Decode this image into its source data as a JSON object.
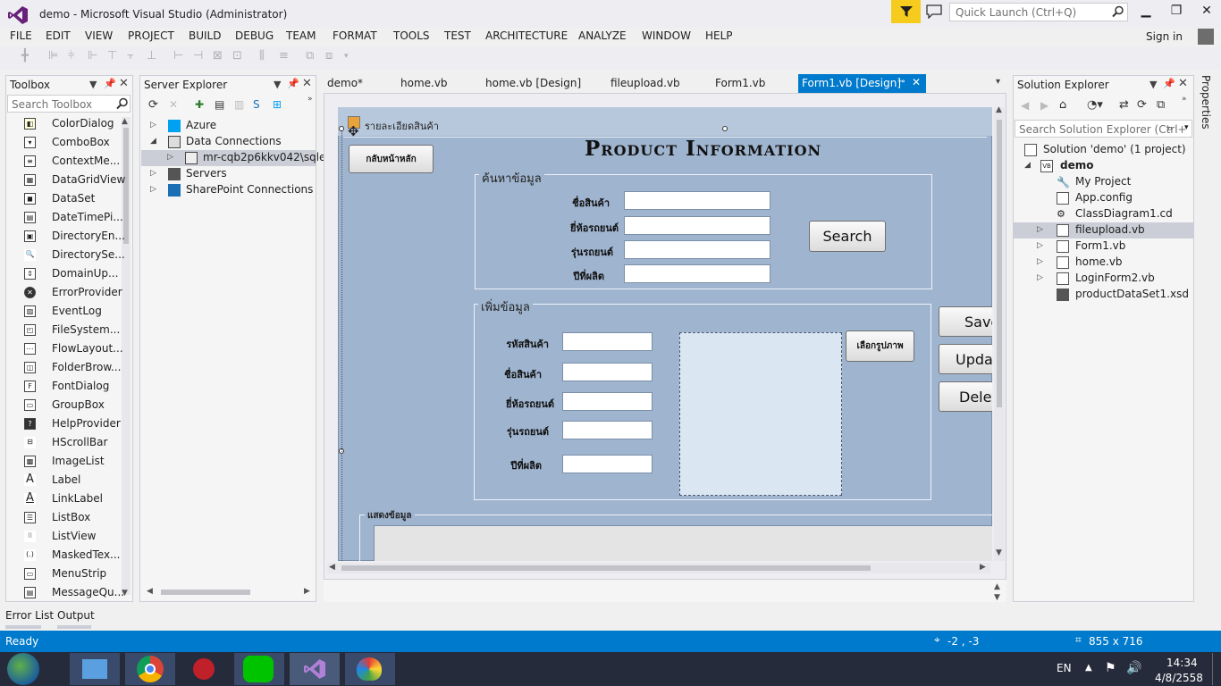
{
  "window": {
    "title": "demo - Microsoft Visual Studio (Administrator)",
    "quick_launch_placeholder": "Quick Launch (Ctrl+Q)",
    "min": "▁",
    "max": "❐",
    "close": "✕",
    "accent": "#007acc"
  },
  "menu": [
    "FILE",
    "EDIT",
    "VIEW",
    "PROJECT",
    "BUILD",
    "DEBUG",
    "TEAM",
    "FORMAT",
    "TOOLS",
    "TEST",
    "ARCHITECTURE",
    "ANALYZE",
    "WINDOW",
    "HELP"
  ],
  "signin": "Sign in",
  "toolbox": {
    "title": "Toolbox",
    "search_placeholder": "Search Toolbox",
    "items": [
      "ColorDialog",
      "ComboBox",
      "ContextMe...",
      "DataGridView",
      "DataSet",
      "DateTimePi...",
      "DirectoryEn...",
      "DirectorySe...",
      "DomainUp...",
      "ErrorProvider",
      "EventLog",
      "FileSystem...",
      "FlowLayout...",
      "FolderBrow...",
      "FontDialog",
      "GroupBox",
      "HelpProvider",
      "HScrollBar",
      "ImageList",
      "Label",
      "LinkLabel",
      "ListBox",
      "ListView",
      "MaskedTex...",
      "MenuStrip",
      "MessageQu..."
    ]
  },
  "server_explorer": {
    "title": "Server Explorer",
    "nodes": [
      "Azure",
      "Data Connections",
      "mr-cqb2p6kkv042\\sqlex",
      "Servers",
      "SharePoint Connections"
    ]
  },
  "doc_tabs": [
    "demo*",
    "home.vb",
    "home.vb [Design]",
    "fileupload.vb",
    "Form1.vb",
    "Form1.vb [Design]"
  ],
  "form": {
    "caption": "รายละเอียดสินค้า",
    "heading": "Product Information",
    "back_button": "กลับหน้าหลัก",
    "search_group": {
      "title": "ค้นหาข้อมูล",
      "labels": [
        "ชื่อสินค้า",
        "ยี่ห้อรถยนต์",
        "รุ่นรถยนต์",
        "ปีที่ผลิต"
      ],
      "search_button": "Search"
    },
    "add_group": {
      "title": "เพิ่มข้อมูล",
      "labels": [
        "รหัสสินค้า",
        "ชื่อสินค้า",
        "ยี่ห้อรถยนต์",
        "รุ่นรถยนต์",
        "ปีที่ผลิต"
      ],
      "pick_image_button": "เลือกรูปภาพ"
    },
    "save_button": "Save",
    "update_button": "Upda",
    "delete_button": "Delet",
    "display_group": "แสดงข้อมูล"
  },
  "solution_explorer": {
    "title": "Solution Explorer",
    "search_placeholder": "Search Solution Explorer (Ctrl+",
    "solution": "Solution 'demo' (1 project)",
    "project": "demo",
    "items": [
      "My Project",
      "App.config",
      "ClassDiagram1.cd",
      "fileupload.vb",
      "Form1.vb",
      "home.vb",
      "LoginForm2.vb",
      "productDataSet1.xsd"
    ]
  },
  "properties_tab": "Properties",
  "bottom_tabs": [
    "Error List",
    "Output"
  ],
  "status": {
    "ready": "Ready",
    "position": "-2 , -3",
    "size": "855 x 716"
  },
  "taskbar": {
    "lang": "EN",
    "time": "14:34",
    "date": "4/8/2558"
  }
}
